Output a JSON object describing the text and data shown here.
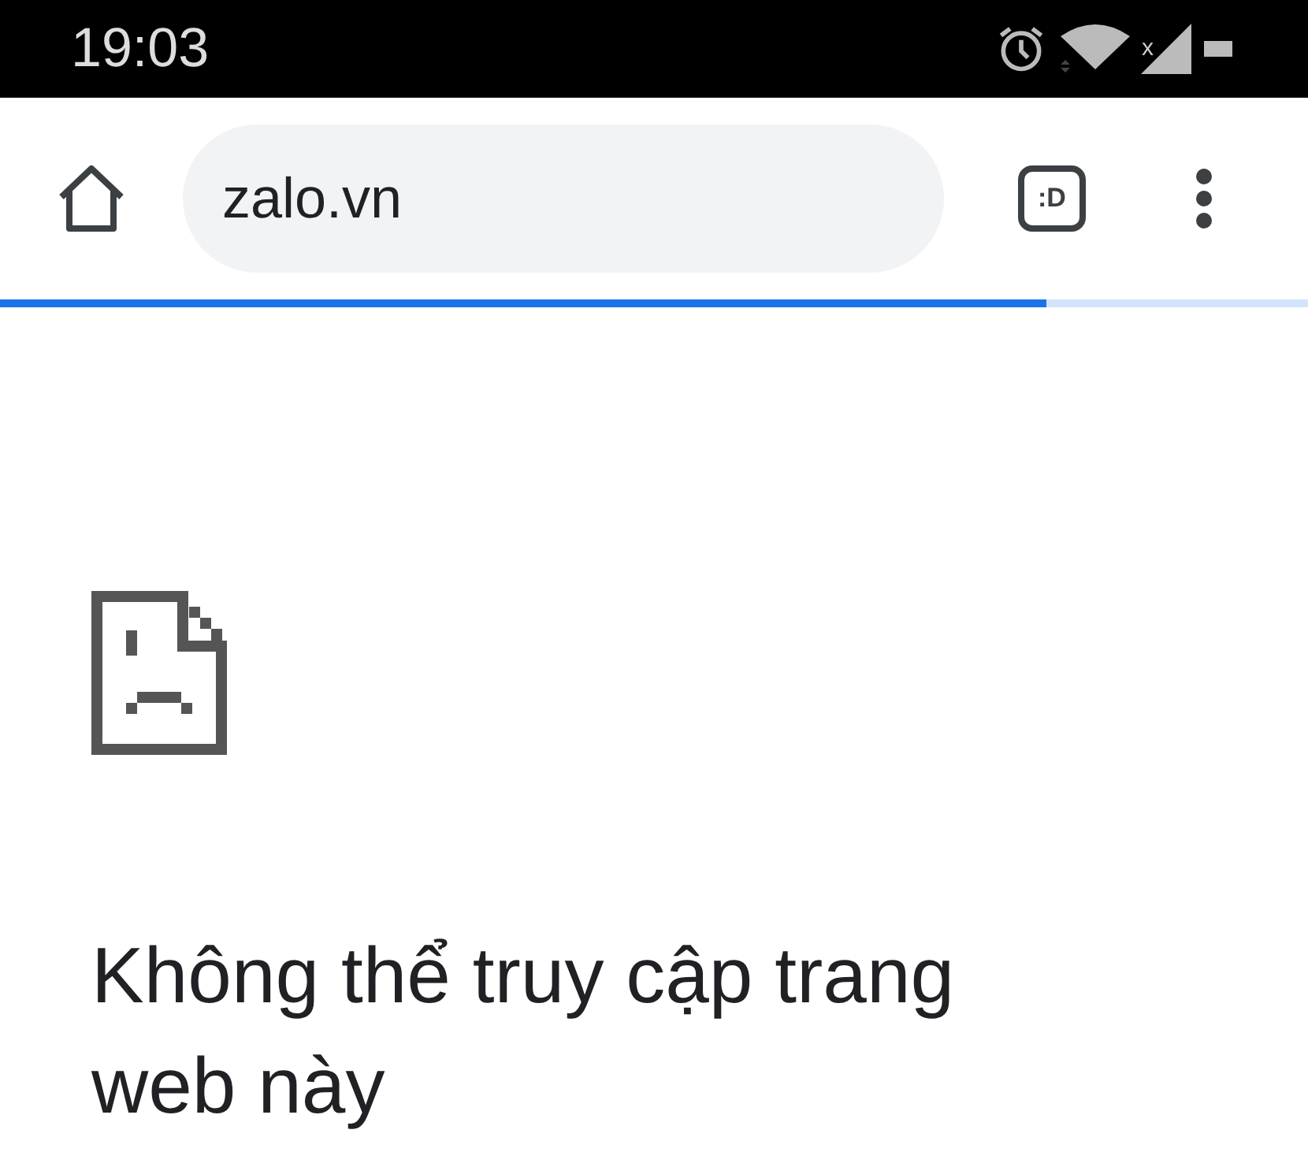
{
  "status_bar": {
    "time": "19:03",
    "mobile_data_off_mark": "x"
  },
  "toolbar": {
    "url": "zalo.vn",
    "tab_switcher": ":D"
  },
  "progress": {
    "level": 0.8
  },
  "error": {
    "heading": "Không thể truy cập trang web này"
  }
}
